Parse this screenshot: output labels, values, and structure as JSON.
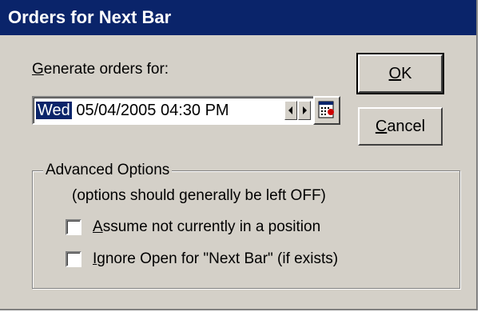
{
  "window": {
    "title": "Orders for Next Bar"
  },
  "generate": {
    "label_hotkey": "G",
    "label_rest": "enerate orders for:",
    "day": "Wed",
    "datetime": "05/04/2005 04:30 PM"
  },
  "buttons": {
    "ok_hotkey": "O",
    "ok_rest": "K",
    "cancel_hotkey": "C",
    "cancel_rest": "ancel"
  },
  "advanced": {
    "title": "Advanced Options",
    "note": "(options should generally be left OFF)",
    "options": [
      {
        "hotkey": "A",
        "rest": "ssume not currently in a position",
        "checked": false
      },
      {
        "hotkey": "I",
        "rest": "gnore Open for \"Next Bar\" (if exists)",
        "checked": false
      }
    ]
  },
  "icons": {
    "spin_left": "left-arrow-icon",
    "spin_right": "right-arrow-icon",
    "calendar": "calendar-icon"
  },
  "colors": {
    "titlebar": "#0a246a",
    "face": "#d4d0c8",
    "selection": "#0a246a"
  }
}
